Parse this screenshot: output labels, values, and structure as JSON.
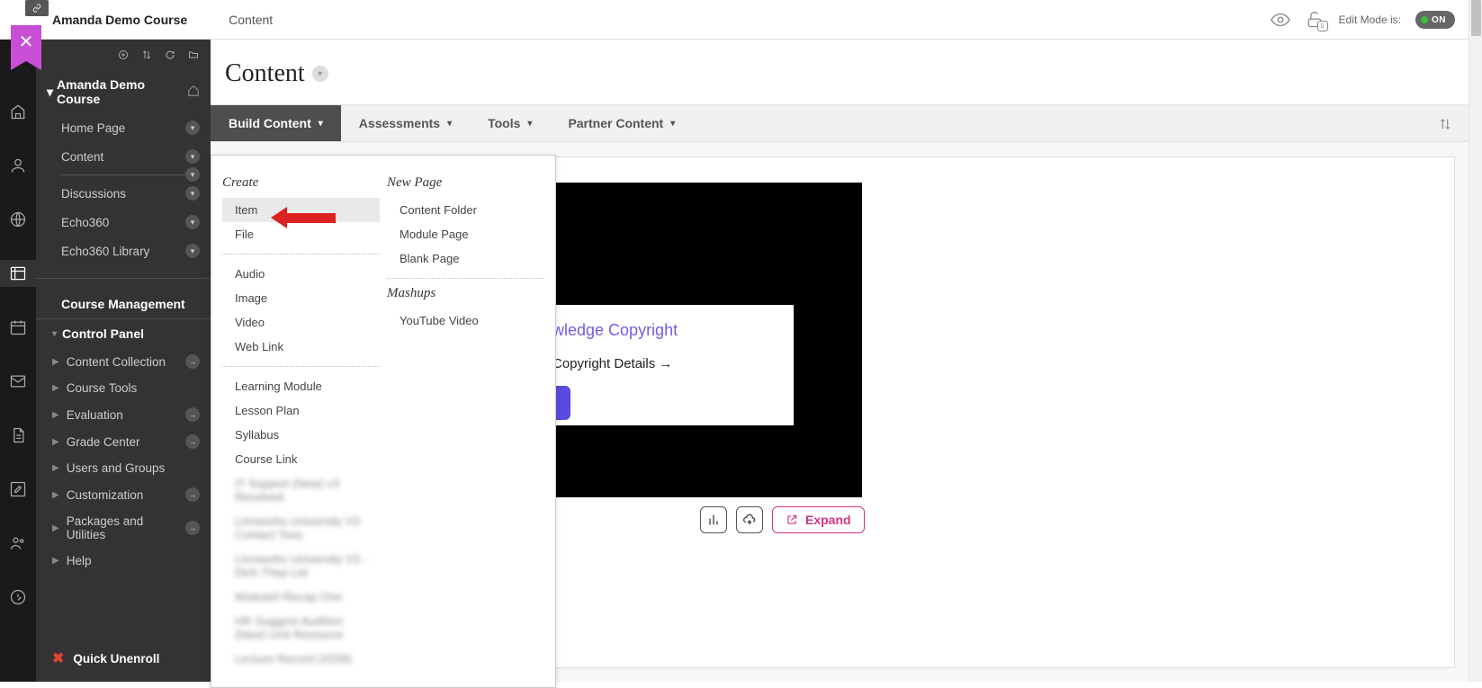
{
  "breadcrumb": {
    "course": "Amanda Demo Course",
    "page": "Content"
  },
  "topbar": {
    "editModeLabel": "Edit Mode is:",
    "toggleText": "ON",
    "lockCount": "0"
  },
  "sidebar": {
    "courseTitle": "Amanda Demo Course",
    "nav": [
      {
        "label": "Home Page"
      },
      {
        "label": "Content"
      },
      {
        "label": "Discussions"
      },
      {
        "label": "Echo360"
      },
      {
        "label": "Echo360 Library"
      }
    ],
    "sectionHead": "Course Management",
    "controlPanel": "Control Panel",
    "mgmt": [
      {
        "label": "Content Collection"
      },
      {
        "label": "Course Tools"
      },
      {
        "label": "Evaluation"
      },
      {
        "label": "Grade Center"
      },
      {
        "label": "Users and Groups"
      },
      {
        "label": "Customization"
      },
      {
        "label": "Packages and Utilities"
      },
      {
        "label": "Help"
      }
    ],
    "quickUnenroll": "Quick Unenroll"
  },
  "pageTitle": "Content",
  "actionTabs": {
    "build": "Build Content",
    "assessments": "Assessments",
    "tools": "Tools",
    "partner": "Partner Content"
  },
  "dropdown": {
    "createHead": "Create",
    "create1": [
      {
        "label": "Item",
        "hl": true
      },
      {
        "label": "File"
      }
    ],
    "create2": [
      {
        "label": "Audio"
      },
      {
        "label": "Image"
      },
      {
        "label": "Video"
      },
      {
        "label": "Web Link"
      }
    ],
    "create3": [
      {
        "label": "Learning Module"
      },
      {
        "label": "Lesson Plan"
      },
      {
        "label": "Syllabus"
      },
      {
        "label": "Course Link"
      }
    ],
    "newPageHead": "New Page",
    "newPage": [
      {
        "label": "Content Folder"
      },
      {
        "label": "Module Page"
      },
      {
        "label": "Blank Page"
      }
    ],
    "mashupsHead": "Mashups",
    "mashups": [
      {
        "label": "YouTube Video"
      }
    ],
    "blurred": [
      "IT Support (New) v3 Resolved",
      "Linnworks University V3 Contact Toes",
      "Linnworks University V3 - Dich Thep Ltd",
      "Module0 Recap One",
      "HR Suggest Audition (New) Unit Resource",
      "Lecture Record (#258)"
    ]
  },
  "videoCard": {
    "title": "wledge Copyright",
    "sub": "Copyright Details",
    "expand": "Expand"
  }
}
